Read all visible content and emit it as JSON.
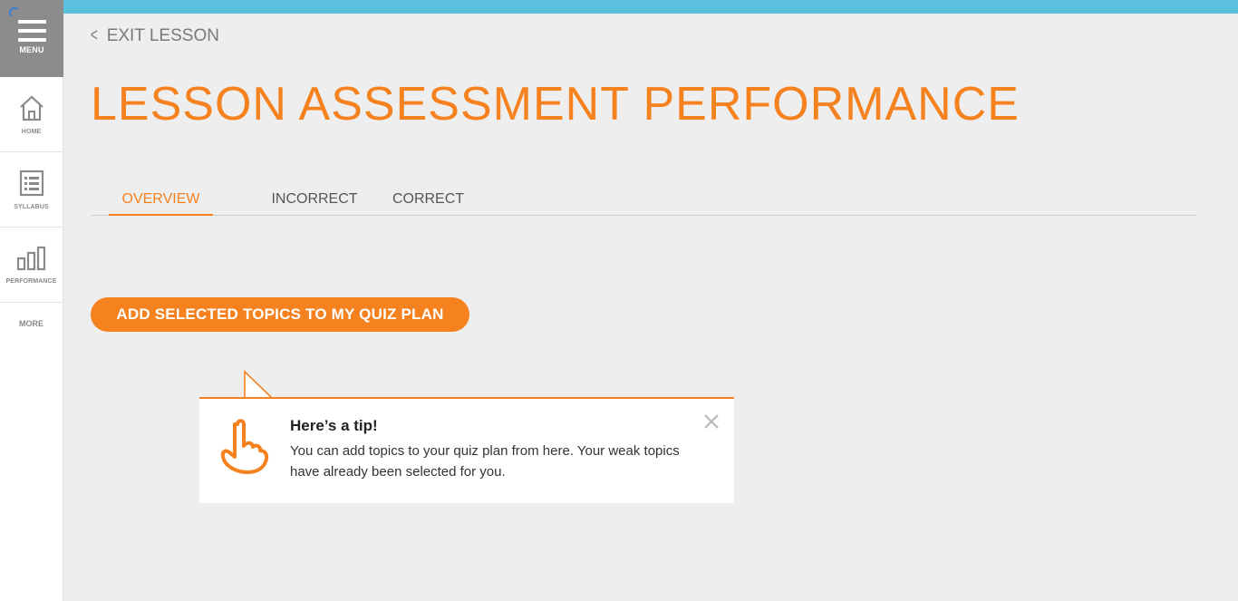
{
  "colors": {
    "accent": "#f5821f",
    "top_bar": "#5bc0de",
    "menu_bg": "#8c8c8c",
    "background": "#eeeeee"
  },
  "sidebar": {
    "menu_label": "MENU",
    "items": [
      {
        "label": "HOME",
        "icon": "home-icon"
      },
      {
        "label": "SYLLABUS",
        "icon": "list-icon"
      },
      {
        "label": "PERFORMANCE",
        "icon": "bar-chart-icon"
      }
    ],
    "more_label": "MORE"
  },
  "header": {
    "exit_label": "EXIT LESSON",
    "page_title": "LESSON ASSESSMENT PERFORMANCE"
  },
  "tabs": [
    {
      "label": "OVERVIEW",
      "active": true
    },
    {
      "label": "INCORRECT",
      "active": false
    },
    {
      "label": "CORRECT",
      "active": false
    }
  ],
  "actions": {
    "add_topics_label": "ADD SELECTED TOPICS TO MY QUIZ PLAN"
  },
  "tip": {
    "title": "Here’s a tip!",
    "body": "You can add topics to your quiz plan from here. Your weak topics have already been selected for you.",
    "icon": "pointing-hand-icon"
  }
}
